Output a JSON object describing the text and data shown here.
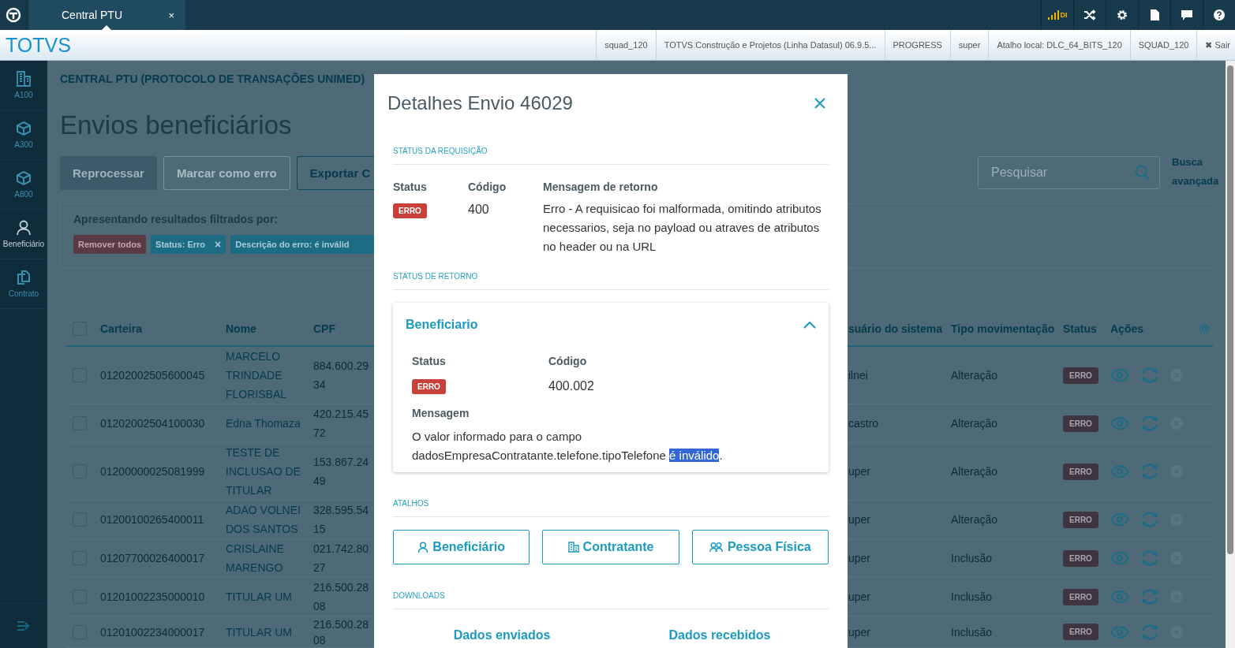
{
  "top_bar": {
    "tabs": [
      {
        "label": "Central PTU",
        "close": "×",
        "selected": true
      }
    ],
    "signal_label": "DI"
  },
  "header": {
    "brand": "TOTVS",
    "info": [
      "squad_120",
      "TOTVS Construção e Projetos (Linha Datasul) 06.9.5...",
      "PROGRESS",
      "super",
      "Atalho local: DLC_64_BITS_120",
      "SQUAD_120"
    ],
    "logout_icon": "✖",
    "logout": "Sair"
  },
  "sidebar": {
    "items": [
      {
        "label": "A100",
        "selected": false
      },
      {
        "label": "A300",
        "selected": false
      },
      {
        "label": "A800",
        "selected": false
      },
      {
        "label": "Beneficiário",
        "selected": true
      },
      {
        "label": "Contrato",
        "selected": false
      }
    ]
  },
  "page": {
    "breadcrumb": "CENTRAL PTU (PROTOCOLO DE TRANSAÇÕES UNIMED)",
    "title": "Envios beneficiários",
    "actions": [
      {
        "label": "Reprocessar",
        "disabled": true,
        "kind": "primary"
      },
      {
        "label": "Marcar como erro",
        "disabled": true,
        "kind": "secondary"
      },
      {
        "label": "Exportar C",
        "disabled": false,
        "kind": "secondary"
      }
    ],
    "search": {
      "placeholder": "Pesquisar"
    },
    "advanced_search": "Busca avançada",
    "filters": {
      "label": "Apresentando resultados filtrados por:",
      "remove_all": "Remover todos",
      "chips": [
        {
          "label": "Status: Erro",
          "close": "×"
        },
        {
          "label": "Descrição do erro: é inválid"
        }
      ]
    }
  },
  "table": {
    "all_checked": false,
    "columns_left": [
      "Carteira",
      "Nome",
      "CPF"
    ],
    "columns_right": [
      "suário do sistema",
      "Tipo movimentação",
      "Status",
      "Ações"
    ],
    "rows": [
      {
        "checked": false,
        "carteira": "01202002505600045",
        "nome": "MARCELO TRINDADE FLORISBAL",
        "cpf": [
          "884.600.29",
          "34"
        ],
        "usuario": "ilnei",
        "tipo": "Alteração",
        "status": "ERRO",
        "cancel_disabled": true
      },
      {
        "checked": false,
        "carteira": "01202002504100030",
        "nome": "Edna Thomaza",
        "cpf": [
          "420.215.45",
          "72"
        ],
        "usuario": "castro",
        "tipo": "Alteração",
        "status": "ERRO",
        "cancel_disabled": true
      },
      {
        "checked": false,
        "carteira": "01200000025081999",
        "nome": "TESTE DE INCLUSAO DE TITULAR",
        "cpf": [
          "153.867.24",
          "49"
        ],
        "usuario": "uper",
        "tipo": "Alteração",
        "status": "ERRO",
        "cancel_disabled": true
      },
      {
        "checked": false,
        "carteira": "01200100265400011",
        "nome": "ADAO VOLNEI DOS SANTOS",
        "cpf": [
          "328.595.54",
          "15"
        ],
        "usuario": "uper",
        "tipo": "Alteração",
        "status": "ERRO",
        "cancel_disabled": true
      },
      {
        "checked": false,
        "carteira": "01207700026400017",
        "nome": "CRISLAINE MARENGO",
        "cpf": [
          "021.742.80",
          "27"
        ],
        "usuario": "uper",
        "tipo": "Inclusão",
        "status": "ERRO",
        "cancel_disabled": true
      },
      {
        "checked": false,
        "carteira": "01201002235000010",
        "nome": "TITULAR UM",
        "cpf": [
          "216.500.28",
          "08"
        ],
        "usuario": "uper",
        "tipo": "Inclusão",
        "status": "ERRO",
        "cancel_disabled": true
      },
      {
        "checked": false,
        "carteira": "01201002234000017",
        "nome": "TITULAR UM",
        "cpf": [
          "216.500.28",
          "08"
        ],
        "usuario": "uper",
        "tipo": "Inclusão",
        "status": "ERRO",
        "cancel_disabled": true
      }
    ]
  },
  "modal": {
    "title": "Detalhes Envio 46029",
    "request": {
      "heading": "STATUS DA REQUISIÇÃO",
      "status_label": "Status",
      "code_label": "Código",
      "message_label": "Mensagem de retorno",
      "status": "ERRO",
      "code": "400",
      "message": "Erro - A requisicao foi malformada, omitindo atributos necessarios, seja no payload ou atraves de atributos no header ou na URL"
    },
    "return": {
      "heading": "STATUS DE RETORNO",
      "card": {
        "title": "Beneficiario",
        "expanded": true,
        "status_label": "Status",
        "code_label": "Código",
        "status": "ERRO",
        "code": "400.002",
        "message_label": "Mensagem",
        "message_parts": [
          {
            "text": "O valor informado para o campo dadosEmpresaContratante.telefone.tipoTelefone ",
            "selected": false
          },
          {
            "text": "é inválido",
            "selected": true
          },
          {
            "text": ".",
            "selected": false
          }
        ]
      }
    },
    "shortcuts": {
      "heading": "ATALHOS",
      "buttons": [
        "Beneficiário",
        "Contratante",
        "Pessoa Física"
      ]
    },
    "downloads": {
      "heading": "DOWNLOADS",
      "items": [
        "Dados enviados",
        "Dados recebidos"
      ]
    }
  }
}
